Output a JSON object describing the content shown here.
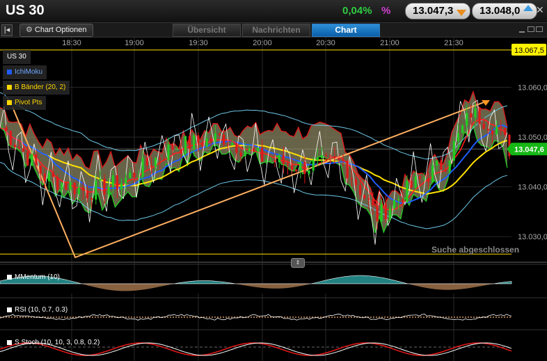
{
  "header": {
    "symbol": "US 30",
    "change_pct": "0,04%",
    "pct_sign": "%",
    "bid": "13.047,3",
    "ask": "13.048,0",
    "close_label": "✕"
  },
  "toolbar": {
    "collapse_label": "|◂",
    "chart_options_label": "Chart Optionen",
    "tabs": [
      {
        "label": "Übersicht",
        "active": false
      },
      {
        "label": "Nachrichten",
        "active": false
      },
      {
        "label": "Chart",
        "active": true
      }
    ]
  },
  "legend": {
    "symbol_label": "US 30",
    "items": [
      {
        "label": "IchiMoku",
        "color": "#1e5cff"
      },
      {
        "label": "B Bänder (20, 2)",
        "color": "#ffd700"
      },
      {
        "label": "Pivot Pts",
        "color": "#ffd700"
      }
    ]
  },
  "chart_data": {
    "type": "candlestick",
    "time_labels": [
      "18:30",
      "19:00",
      "19:30",
      "20:00",
      "20:30",
      "21:00",
      "21:30"
    ],
    "price_labels": [
      "13.060,0",
      "13.050,0",
      "13.040,0",
      "13.030,0"
    ],
    "price_values": [
      13060,
      13050,
      13040,
      13030
    ],
    "ylim": [
      13025,
      13070
    ],
    "pivot_high": "13.067,5",
    "pivot_high_value": 13067.5,
    "current_price": "13.047,6",
    "current_price_value": 13047.6,
    "pivot_low_value": 13026.5,
    "status_text": "Suche abgeschlossen",
    "colors": {
      "up": "#22cc22",
      "down": "#e01818",
      "ichimoku": "#1e5cff",
      "bollinger_mid": "#ffe000",
      "bollinger_band": "#6ec8e8",
      "cloud": "#8a8460",
      "trendline": "#ffb060"
    }
  },
  "indicators": [
    {
      "label": "MMentum (10)"
    },
    {
      "label": "RSI (10, 0.7, 0.3)"
    },
    {
      "label": "S Stoch (10, 10, 3, 0.8, 0.2)"
    }
  ]
}
